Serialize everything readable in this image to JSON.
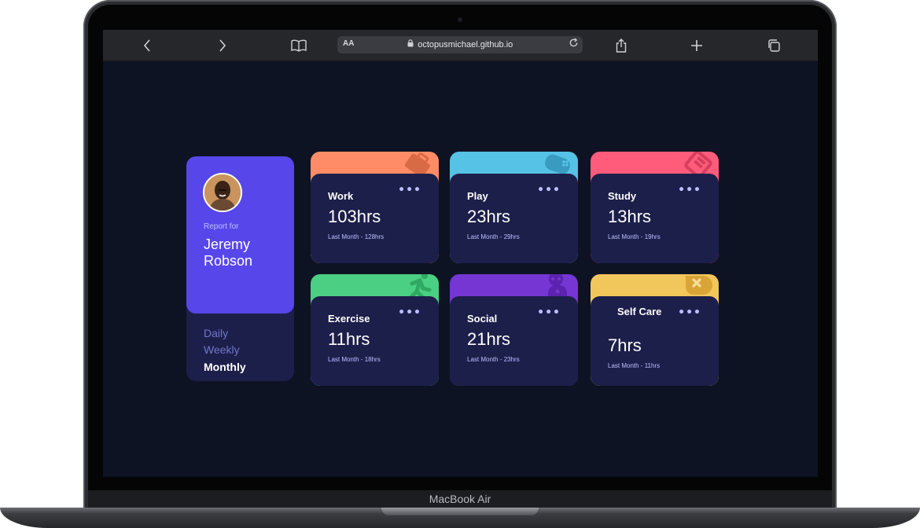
{
  "device": {
    "label": "MacBook Air"
  },
  "browser": {
    "url": "octopusmichael.github.io",
    "reader_label": "AA",
    "icons": {
      "back": "chevron-left-icon",
      "forward": "chevron-right-icon",
      "bookmarks": "book-icon",
      "share": "share-icon",
      "new_tab": "plus-icon",
      "tabs": "tabs-icon",
      "lock": "lock-icon",
      "reload": "reload-icon"
    }
  },
  "profile": {
    "report_for": "Report for",
    "name": "Jeremy Robson",
    "timeframes": [
      "Daily",
      "Weekly",
      "Monthly"
    ],
    "active_timeframe": "Monthly"
  },
  "cards": [
    {
      "title": "Work",
      "hours": "103hrs",
      "previous": "Last Month - 128hrs",
      "color": "#ff8c66",
      "icon": "briefcase-icon"
    },
    {
      "title": "Play",
      "hours": "23hrs",
      "previous": "Last Month - 29hrs",
      "color": "#56c2e6",
      "icon": "gamepad-icon"
    },
    {
      "title": "Study",
      "hours": "13hrs",
      "previous": "Last Month - 19hrs",
      "color": "#ff5c7c",
      "icon": "book-icon"
    },
    {
      "title": "Exercise",
      "hours": "11hrs",
      "previous": "Last Month - 18hrs",
      "color": "#4bcf83",
      "icon": "running-icon"
    },
    {
      "title": "Social",
      "hours": "21hrs",
      "previous": "Last Month - 23hrs",
      "color": "#7536d3",
      "icon": "social-icon"
    },
    {
      "title": "Self Care",
      "hours": "7hrs",
      "previous": "Last Month - 11hrs",
      "color": "#f1c65b",
      "icon": "heart-x-icon"
    }
  ],
  "colors": {
    "page_bg": "#0e1323",
    "card_bg": "#1c1f4a",
    "profile_bg": "#5747ea",
    "muted_text": "#bbc0ff"
  }
}
